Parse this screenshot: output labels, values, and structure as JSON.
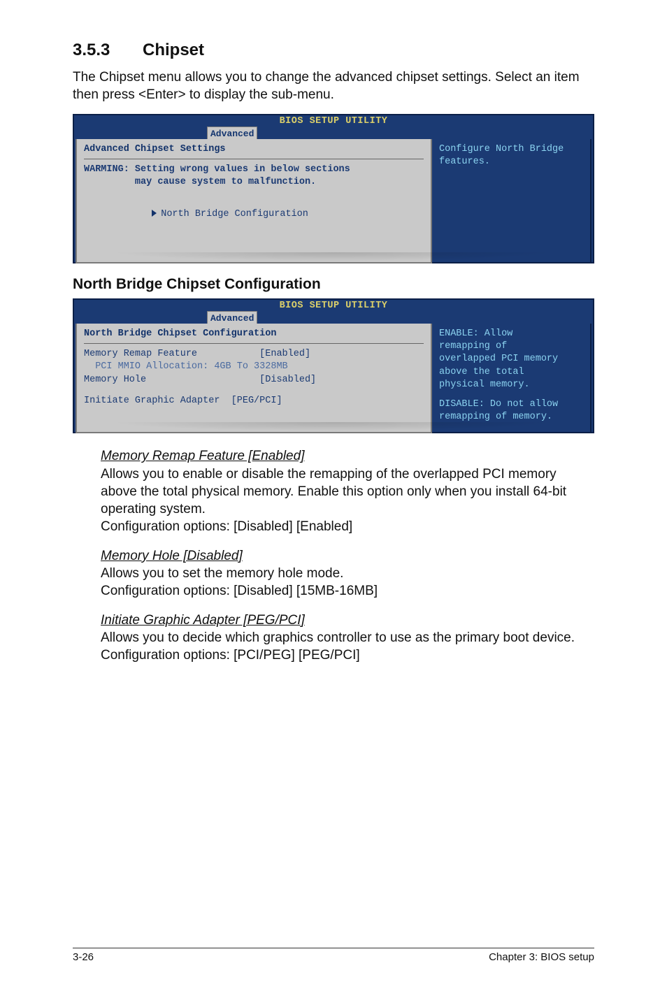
{
  "section": {
    "number": "3.5.3",
    "title": "Chipset"
  },
  "intro": "The Chipset menu allows you to change the advanced chipset settings. Select an item then press <Enter> to display the sub-menu.",
  "bios_common": {
    "title": "BIOS SETUP UTILITY",
    "tab": "Advanced"
  },
  "bios1": {
    "left_heading": "Advanced Chipset Settings",
    "warning_l1": "WARMING: Setting wrong values in below sections",
    "warning_l2": "         may cause system to malfunction.",
    "menu_item": "North Bridge Configuration",
    "right_l1": "Configure North Bridge",
    "right_l2": "features."
  },
  "subhead": "North Bridge Chipset Configuration",
  "bios2": {
    "left_heading": "North Bridge Chipset Configuration",
    "row1": "Memory Remap Feature           [Enabled]",
    "row1b": "  PCI MMIO Allocation: 4GB To 3328MB",
    "row2": "Memory Hole                    [Disabled]",
    "row3": "Initiate Graphic Adapter  [PEG/PCI]",
    "right_l1": "ENABLE: Allow",
    "right_l2": "remapping of",
    "right_l3": "overlapped PCI memory",
    "right_l4": "above the total",
    "right_l5": "physical memory.",
    "right_l6": "DISABLE: Do not allow",
    "right_l7": "remapping of memory."
  },
  "chart_data": [
    {
      "type": "table",
      "title": "North Bridge Chipset Configuration",
      "rows": [
        {
          "setting": "Memory Remap Feature",
          "value": "Enabled"
        },
        {
          "setting": "PCI MMIO Allocation",
          "value": "4GB To 3328MB"
        },
        {
          "setting": "Memory Hole",
          "value": "Disabled"
        },
        {
          "setting": "Initiate Graphic Adapter",
          "value": "PEG/PCI"
        }
      ]
    }
  ],
  "items": {
    "mrf": {
      "title": "Memory Remap Feature [Enabled]",
      "p1": "Allows you to enable or disable the remapping of the overlapped PCI memory above the total physical memory. Enable this option only when you install 64-bit operating system.",
      "p2": "Configuration options: [Disabled] [Enabled]"
    },
    "mh": {
      "title": "Memory Hole [Disabled]",
      "p1": "Allows you to set the memory hole mode.",
      "p2": "Configuration options: [Disabled] [15MB-16MB]"
    },
    "iga": {
      "title": "Initiate Graphic Adapter [PEG/PCI]",
      "p1": "Allows you to decide which graphics controller to use as the primary boot device.",
      "p2": "Configuration options: [PCI/PEG] [PEG/PCI]"
    }
  },
  "footer": {
    "left": "3-26",
    "right": "Chapter 3: BIOS setup"
  }
}
